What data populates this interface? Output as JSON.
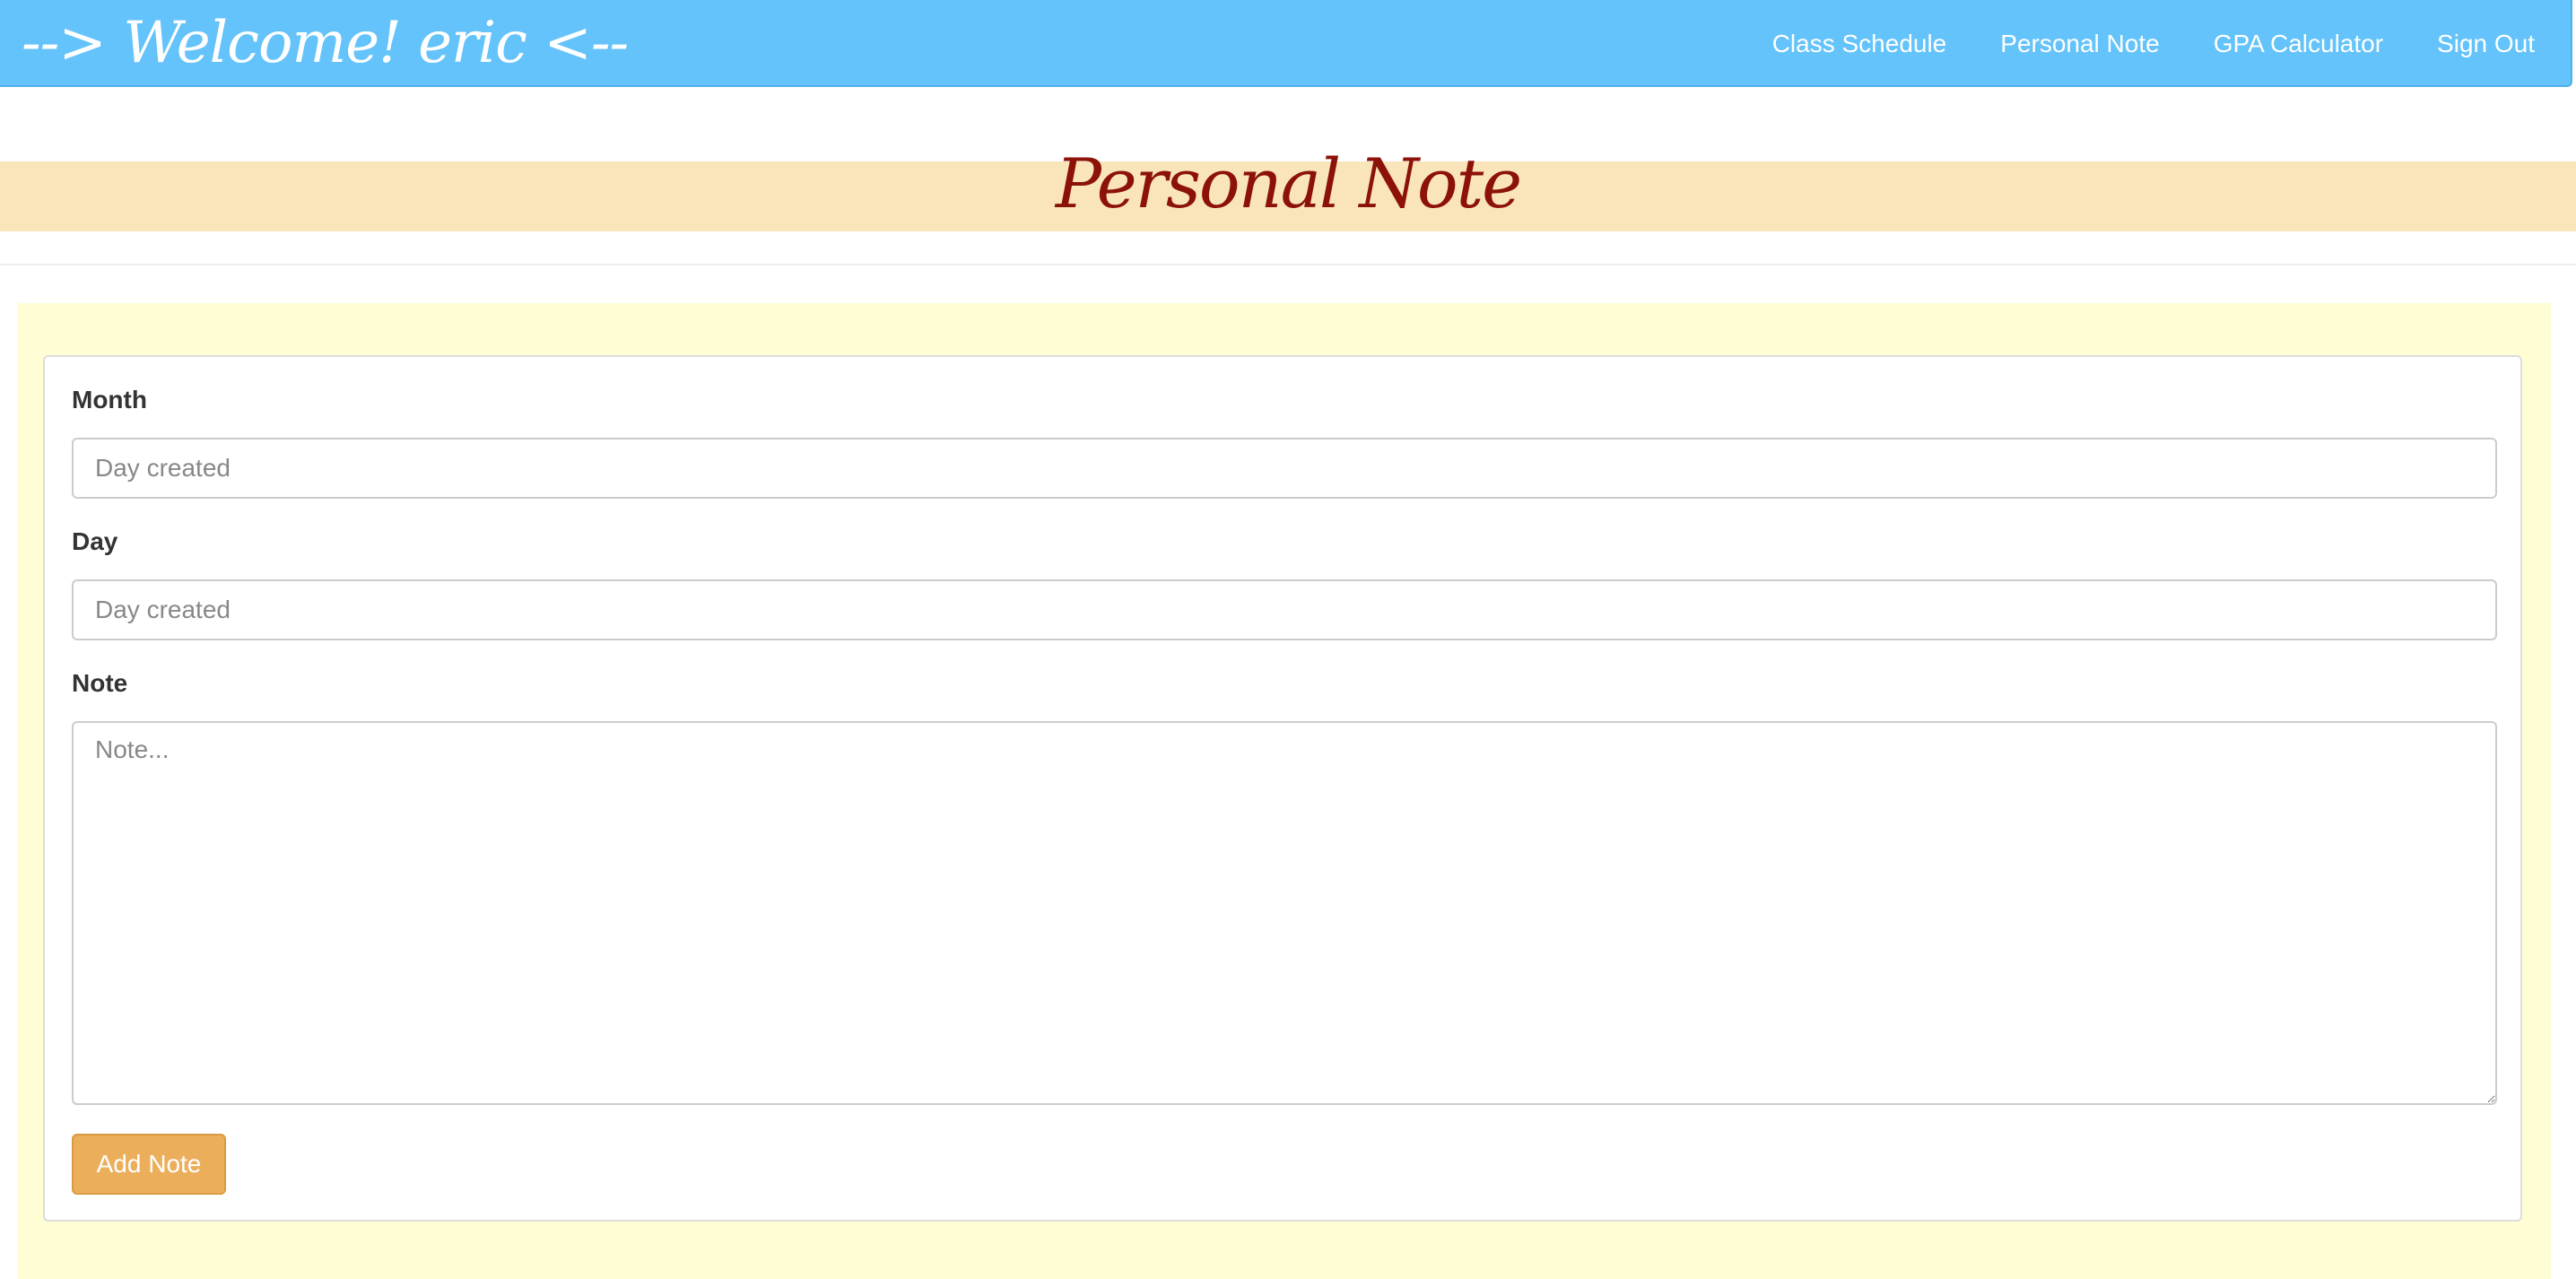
{
  "navbar": {
    "brand": "--> Welcome! eric <--",
    "links": [
      "Class Schedule",
      "Personal Note",
      "GPA Calculator",
      "Sign Out"
    ]
  },
  "page": {
    "title": "Personal Note"
  },
  "form": {
    "month_label": "Month",
    "month_placeholder": "Day created",
    "day_label": "Day",
    "day_placeholder": "Day created",
    "note_label": "Note",
    "note_placeholder": "Note...",
    "submit_label": "Add Note"
  },
  "colors": {
    "navbar": "#63c3fa",
    "title_banner": "#fae5bb",
    "title_text": "#8c1208",
    "section_bg": "#fefdd4",
    "button": "#ebaf5c"
  }
}
